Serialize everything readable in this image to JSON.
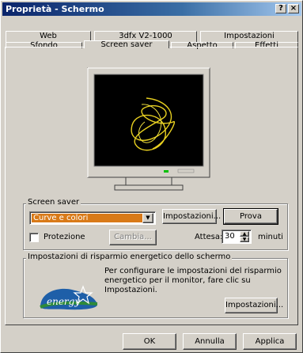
{
  "window": {
    "title": "Proprietà - Schermo",
    "help_label": "?",
    "close_label": "×"
  },
  "tabs_back": [
    {
      "label": "Web"
    },
    {
      "label": "3dfx V2-1000"
    },
    {
      "label": "Impostazioni"
    }
  ],
  "tabs_front": [
    {
      "label": "Sfondo"
    },
    {
      "label": "Screen saver"
    },
    {
      "label": "Aspetto"
    },
    {
      "label": "Effetti"
    }
  ],
  "screensaver": {
    "group_label": "Screen saver",
    "selected": "Curve e colori",
    "settings_button": "Impostazioni...",
    "preview_button": "Prova",
    "password_label": "Protezione",
    "password_checked": false,
    "change_button": "Cambia...",
    "wait_label": "Attesa:",
    "wait_value": "30",
    "wait_unit": "minuti"
  },
  "energy": {
    "group_label": "Impostazioni di risparmio energetico dello schermo",
    "description": "Per configurare le impostazioni del risparmio energetico per il monitor, fare clic su Impostazioni.",
    "settings_button": "Impostazioni...",
    "logo_text": "energy"
  },
  "footer": {
    "ok": "OK",
    "cancel": "Annulla",
    "apply": "Applica"
  },
  "colors": {
    "title_active": "#0a246a",
    "selection": "#d97a18",
    "curve": "#e8d020"
  }
}
